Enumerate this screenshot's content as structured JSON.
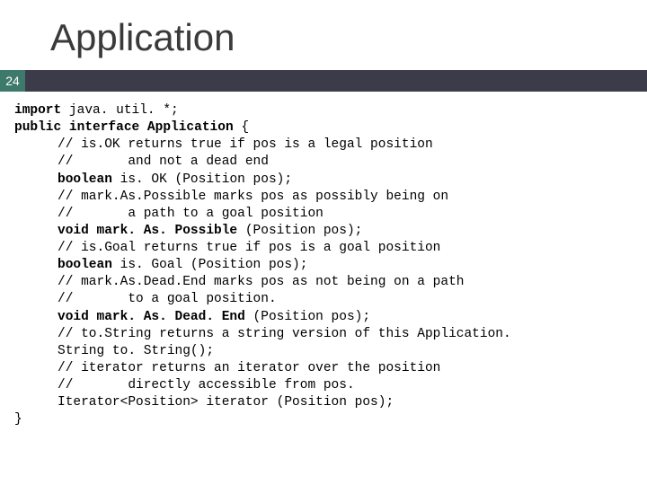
{
  "slide": {
    "title": "Application",
    "page_number": "24"
  },
  "code": {
    "l1a": "import",
    "l1b": " java. util. *;",
    "l2a": "public interface Application",
    "l2b": " {",
    "l3": "// is.OK returns true if pos is a legal position",
    "l4": "//       and not a dead end",
    "l5a": "boolean",
    "l5b": " is. OK (Position pos);",
    "l6": "// mark.As.Possible marks pos as possibly being on",
    "l7": "//       a path to a goal position",
    "l8a": "void mark. As. Possible",
    "l8b": " (Position pos);",
    "l9": "// is.Goal returns true if pos is a goal position",
    "l10a": "boolean",
    "l10b": " is. Goal (Position pos);",
    "l11": "// mark.As.Dead.End marks pos as not being on a path",
    "l12": "//       to a goal position.",
    "l13a": "void mark. As. Dead. End",
    "l13b": " (Position pos);",
    "l14": "// to.String returns a string version of this Application.",
    "l15": "String to. String();",
    "l16": "// iterator returns an iterator over the position",
    "l17": "//       directly accessible from pos.",
    "l18": "Iterator<Position> iterator (Position pos);",
    "l19": "}"
  }
}
